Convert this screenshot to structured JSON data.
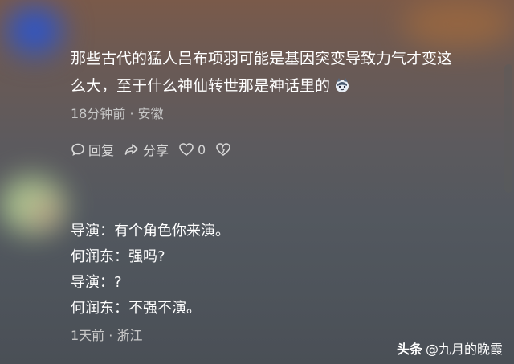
{
  "comment1": {
    "text_line1": "那些古代的猛人吕布项羽可能是基因突变导致力气才变这",
    "text_line2": "么大，至于什么神仙转世那是神话里的",
    "emoji": "cat-emoji",
    "meta": "18分钟前 · 安徽",
    "actions": {
      "reply_label": "回复",
      "share_label": "分享",
      "like_count": "0"
    }
  },
  "comment2": {
    "lines": [
      "导演：有个角色你来演。",
      "何润东：强吗?",
      "导演：?",
      "何润东：不强不演。"
    ],
    "meta": "1天前 · 浙江"
  },
  "watermark": {
    "brand": "头条",
    "account": "@九月的晚霞"
  },
  "colors": {
    "text": "#ffffff",
    "meta": "#c7c7c7"
  }
}
